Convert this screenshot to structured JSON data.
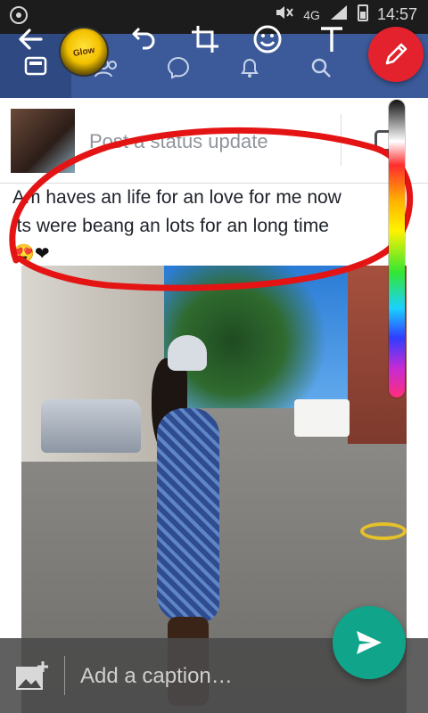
{
  "status_bar": {
    "network": "4G",
    "time": "14:57",
    "icons": [
      "whatsapp-icon",
      "mute-icon",
      "signal-icon",
      "battery-icon"
    ]
  },
  "toolbar": {
    "icons": [
      "back-arrow-icon",
      "sticker-icon",
      "undo-icon",
      "crop-rotate-icon",
      "emoji-icon",
      "text-icon",
      "pencil-icon"
    ],
    "pencil_color": "#e3222d"
  },
  "facebook_nav": {
    "tabs": [
      "news-feed-icon",
      "friends-icon",
      "messenger-icon",
      "notifications-icon",
      "search-icon",
      "menu-icon"
    ],
    "bar_color": "#3c5a99"
  },
  "composer": {
    "prompt": "Post a status update"
  },
  "status_post": {
    "line1": "Am haves an life for an love for me now",
    "line2": "its were beang an lots for an long time",
    "emoji": "😍❤"
  },
  "annotation": {
    "color": "#e41414"
  },
  "caption_bar": {
    "placeholder": "Add a caption…",
    "add_image_icon": "add-photo-icon",
    "send_icon": "send-icon",
    "send_color": "#10a58b"
  }
}
